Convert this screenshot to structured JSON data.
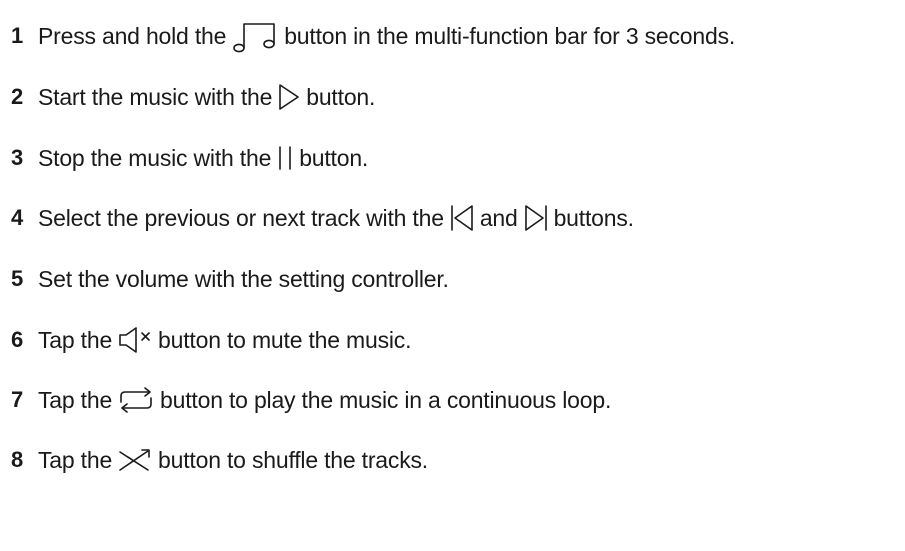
{
  "steps": [
    {
      "number": "1",
      "before": "Press and hold the",
      "icon": "music-notes-icon",
      "after": "button in the multi-function bar for 3 seconds."
    },
    {
      "number": "2",
      "before": "Start the music with the",
      "icon": "play-icon",
      "after": "button."
    },
    {
      "number": "3",
      "before": "Stop the music with the",
      "icon": "pause-icon",
      "after": "button."
    },
    {
      "number": "4",
      "before": "Select the previous or next track with the",
      "icon": "previous-track-icon",
      "middle": "and",
      "icon2": "next-track-icon",
      "after": "buttons."
    },
    {
      "number": "5",
      "text": "Set the volume with the setting controller."
    },
    {
      "number": "6",
      "before": "Tap the",
      "icon": "mute-icon",
      "after": "button to mute the music."
    },
    {
      "number": "7",
      "before": "Tap the",
      "icon": "repeat-icon",
      "after": "button to play the music in a continuous loop."
    },
    {
      "number": "8",
      "before": "Tap the",
      "icon": "shuffle-icon",
      "after": "button to shuffle the tracks."
    }
  ]
}
